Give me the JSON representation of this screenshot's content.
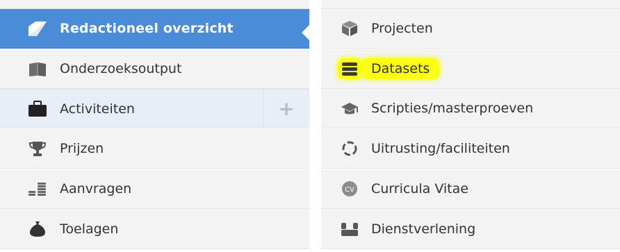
{
  "left_menu": {
    "items": [
      {
        "label": "Redactioneel overzicht",
        "icon": "editorial-overview-icon",
        "state": "active"
      },
      {
        "label": "Onderzoeksoutput",
        "icon": "book-icon"
      },
      {
        "label": "Activiteiten",
        "icon": "briefcase-icon",
        "state": "selected",
        "action_label": "+"
      },
      {
        "label": "Prijzen",
        "icon": "trophy-icon"
      },
      {
        "label": "Aanvragen",
        "icon": "coins-icon"
      },
      {
        "label": "Toelagen",
        "icon": "money-bag-icon"
      }
    ]
  },
  "right_menu": {
    "items": [
      {
        "label": "Projecten",
        "icon": "cube-icon"
      },
      {
        "label": "Datasets",
        "icon": "database-icon",
        "state": "highlighted"
      },
      {
        "label": "Scripties/masterproeven",
        "icon": "graduation-cap-icon"
      },
      {
        "label": "Uitrusting/faciliteiten",
        "icon": "equipment-icon"
      },
      {
        "label": "Curricula Vitae",
        "icon": "cv-icon",
        "badge": "CV"
      },
      {
        "label": "Dienstverlening",
        "icon": "service-icon"
      }
    ]
  },
  "colors": {
    "active_bg": "#4a8cd8",
    "item_bg": "#f3f3f3",
    "selected_bg": "#e7eef8",
    "highlight": "#fbff12",
    "text": "#333333"
  }
}
